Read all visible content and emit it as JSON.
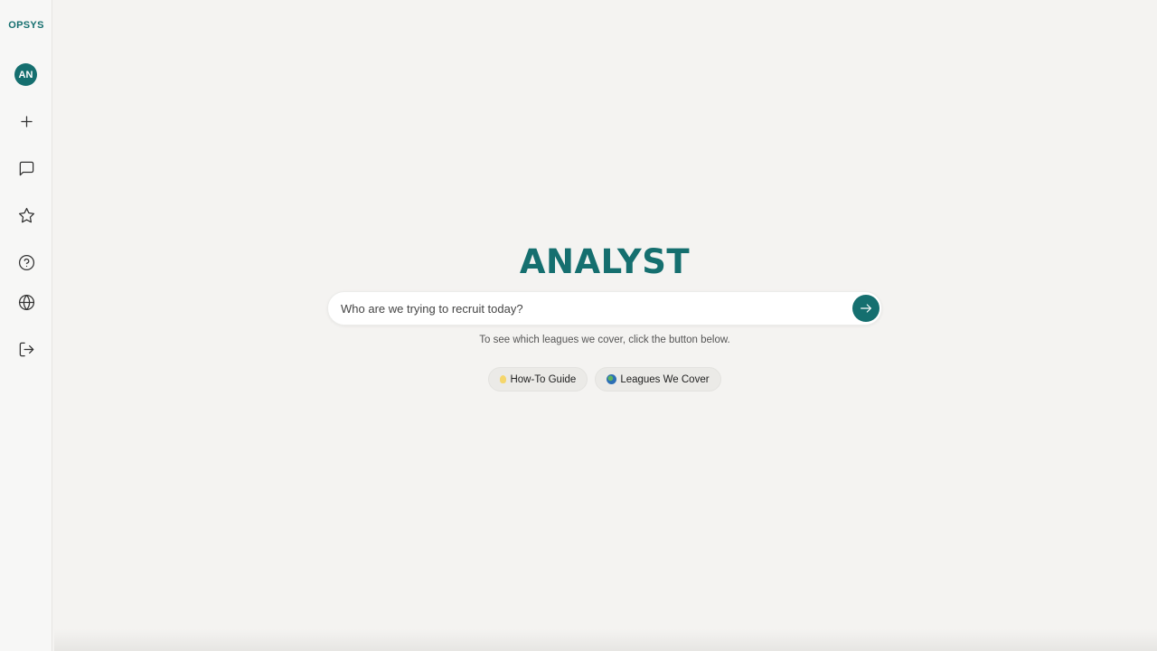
{
  "sidebar": {
    "brand": "OPSYS",
    "avatar_initials": "AN",
    "items": [
      {
        "name": "new-chat",
        "icon": "plus-icon"
      },
      {
        "name": "chats",
        "icon": "message-square-icon"
      },
      {
        "name": "favorites",
        "icon": "star-icon"
      },
      {
        "name": "help",
        "icon": "help-circle-icon"
      },
      {
        "name": "leagues",
        "icon": "globe-icon"
      },
      {
        "name": "logout",
        "icon": "log-out-icon"
      }
    ]
  },
  "main": {
    "title": "ANALYST",
    "search": {
      "placeholder": "Who are we trying to recruit today?",
      "value": "",
      "send_icon": "arrow-right-icon"
    },
    "hint": "To see which leagues we cover, click the button below.",
    "chips": [
      {
        "icon": "lightbulb-icon",
        "label": "How-To Guide"
      },
      {
        "icon": "globe-emoji-icon",
        "label": "Leagues We Cover"
      }
    ]
  },
  "colors": {
    "accent": "#156f6f",
    "background": "#f4f3f1",
    "sidebar_bg": "#f7f7f6",
    "chip_bg": "#ebeae7"
  }
}
